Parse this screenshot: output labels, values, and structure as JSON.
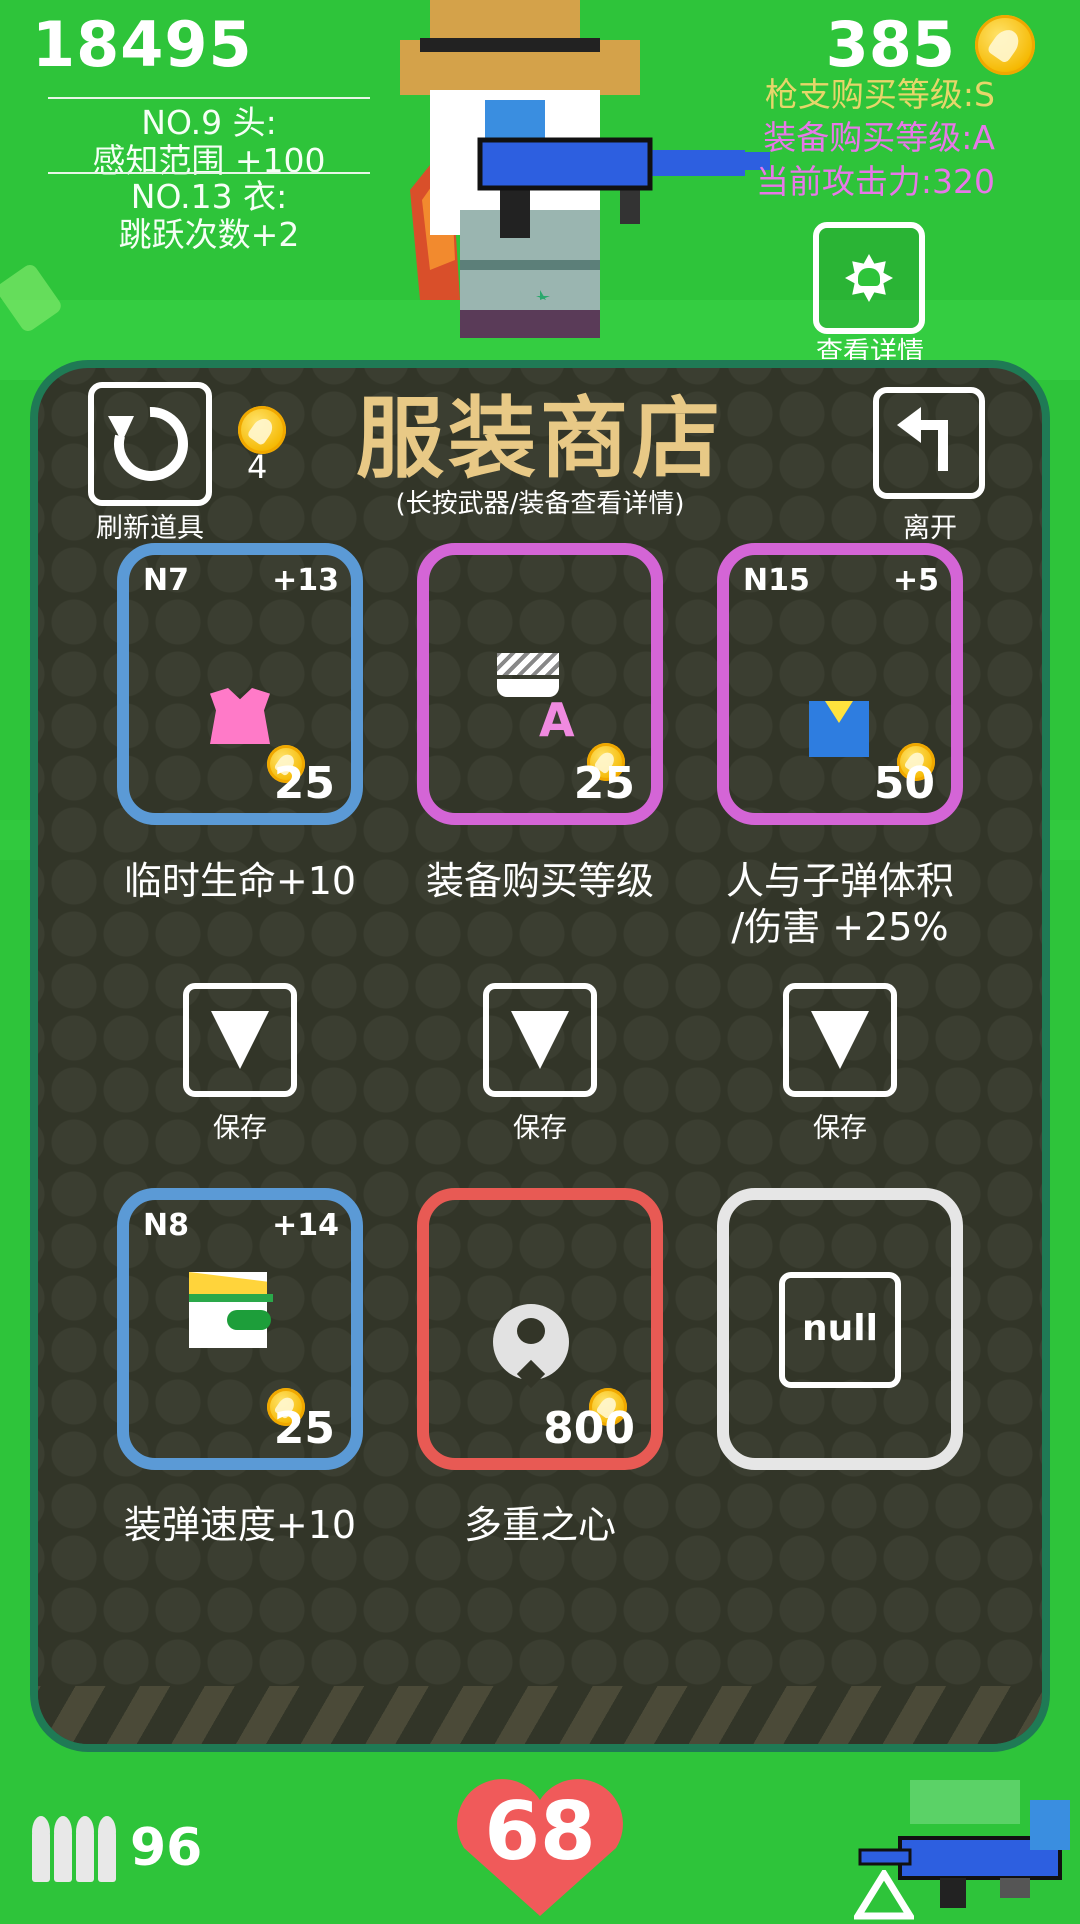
{
  "hud": {
    "score": "18495",
    "equipment": [
      {
        "line1": "NO.9 头:",
        "line2": "感知范围 +100"
      },
      {
        "line1": "NO.13 衣:",
        "line2": "跳跃次数+2"
      }
    ],
    "coins": "385",
    "gun_level": "枪支购买等级:S",
    "equip_level": "装备购买等级:A",
    "attack": "当前攻击力:320",
    "details_label": "查看详情"
  },
  "shop": {
    "title": "服装商店",
    "subtitle": "(长按武器/装备查看详情)",
    "refresh_label": "刷新道具",
    "refresh_cost": "4",
    "leave_label": "离开",
    "items": [
      {
        "code": "N7",
        "bonus": "+13",
        "price": "25",
        "label": "临时生命+10",
        "border": "#5b9ad6"
      },
      {
        "code": "",
        "bonus": "",
        "price": "25",
        "label": "装备购买等级",
        "border": "#d465d6"
      },
      {
        "code": "N15",
        "bonus": "+5",
        "price": "50",
        "label": "人与子弹体积\n/伤害 +25%",
        "border": "#d465d6"
      },
      {
        "code": "N8",
        "bonus": "+14",
        "price": "25",
        "label": "装弹速度+10",
        "border": "#5b9ad6"
      },
      {
        "code": "",
        "bonus": "",
        "price": "800",
        "label": "多重之心",
        "border": "#e85a54"
      },
      {
        "code": "",
        "bonus": "",
        "price": "",
        "label": "",
        "border": "#e6e6e6",
        "placeholder": "null"
      }
    ],
    "save_label": "保存"
  },
  "bottom": {
    "ammo": "96",
    "health": "68"
  },
  "colors": {
    "background": "#2ec43a",
    "panel": "#323528",
    "panel_border": "#1f7a55",
    "title": "#e8c986",
    "gun_level_color": "#e6d66a",
    "equip_level_color": "#e778e8",
    "heart": "#f05a5a"
  }
}
